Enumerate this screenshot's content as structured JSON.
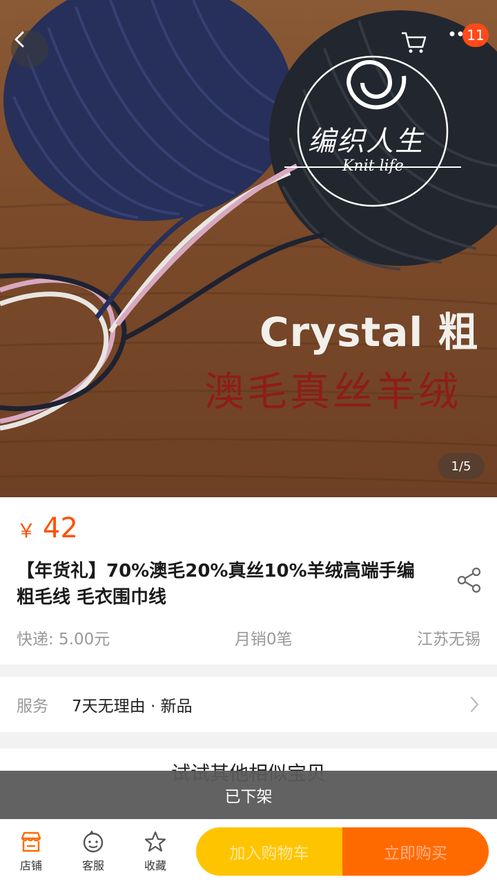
{
  "hero": {
    "logo_cn": "编织人生",
    "logo_en": "Knit life",
    "headline": "Crystal 粗",
    "subline": "澳毛真丝羊绒",
    "pager": "1/5",
    "cart_badge": "11"
  },
  "product": {
    "currency": "￥",
    "price": "42",
    "title": "【年货礼】70%澳毛20%真丝10%羊绒高端手编粗毛线 毛衣围巾线",
    "shipping": "快递: 5.00元",
    "monthly_sales": "月销0笔",
    "location": "江苏无锡"
  },
  "service": {
    "label": "服务",
    "value": "7天无理由 · 新品"
  },
  "similar": {
    "heading": "试试其他相似宝贝"
  },
  "status": {
    "off_shelf": "已下架"
  },
  "bottom_bar": {
    "shop": "店铺",
    "customer_service": "客服",
    "favorite": "收藏",
    "add_to_cart": "加入购物车",
    "buy_now": "立即购买"
  },
  "colors": {
    "accent": "#ff5000",
    "cart_button": "#ffc400",
    "buy_button": "#ff6a00",
    "badge": "#ff4a1a"
  }
}
